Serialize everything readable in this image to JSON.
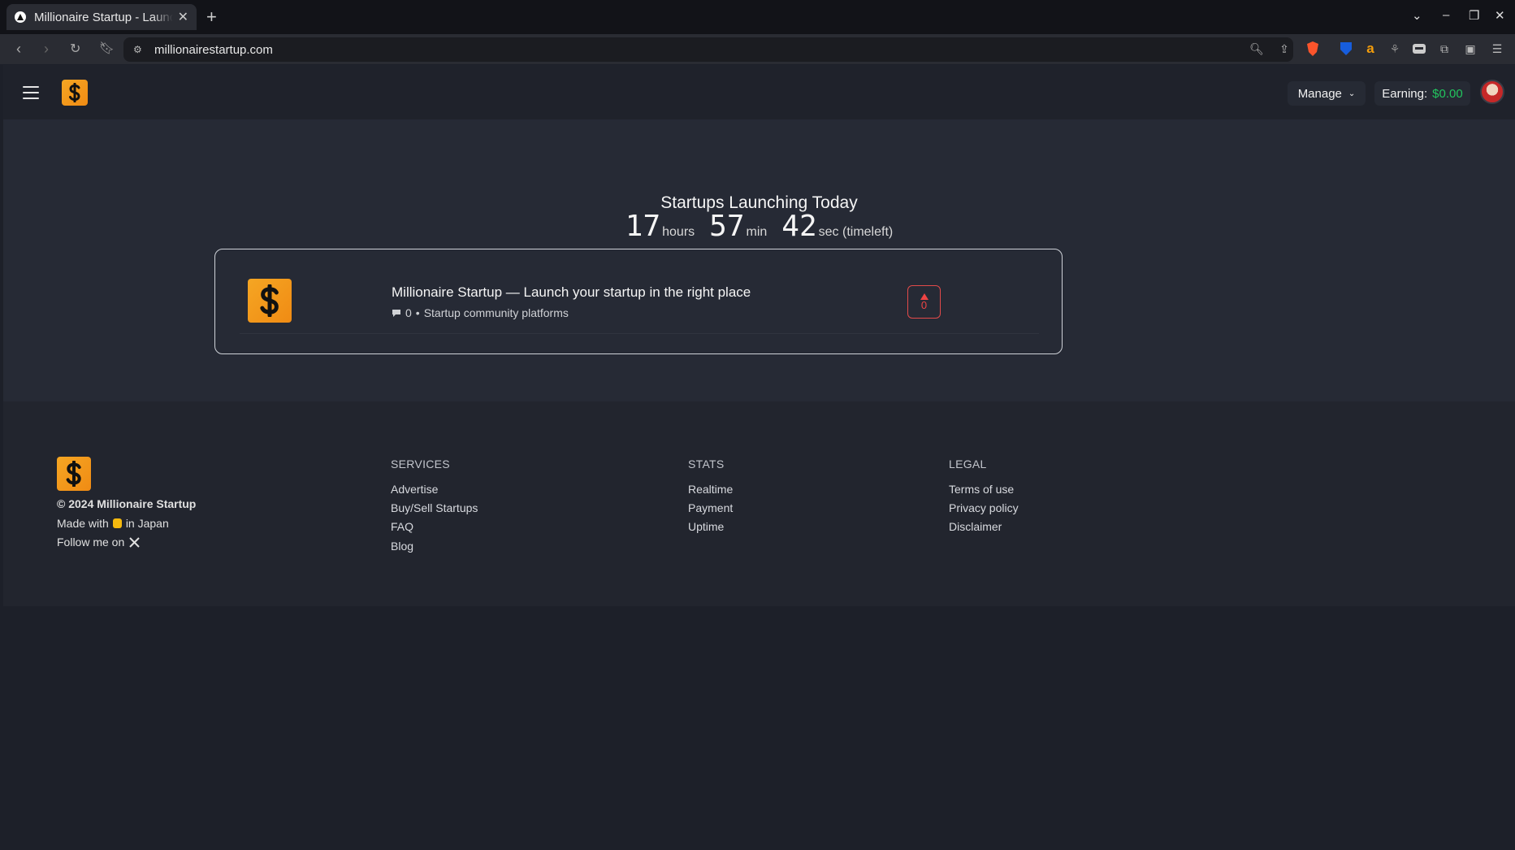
{
  "browser": {
    "tab_title": "Millionaire Startup - Launch",
    "url": "millionairestartup.com"
  },
  "header": {
    "manage_label": "Manage",
    "earning_label": "Earning:",
    "earning_value": "$0.00"
  },
  "hero": {
    "title": "Startups Launching Today",
    "hours": "17",
    "hours_unit": "hours",
    "minutes": "57",
    "minutes_unit": "min",
    "seconds": "42",
    "seconds_unit": "sec (timeleft)"
  },
  "listing": {
    "title": "Millionaire Startup — Launch your startup in the right place",
    "comments": "0",
    "separator": "•",
    "category": "Startup community platforms",
    "upvotes": "0"
  },
  "footer": {
    "copyright": "© 2024 Millionaire Startup",
    "made_with_prefix": "Made with",
    "made_with_suffix": "in Japan",
    "follow": "Follow me on",
    "columns": [
      {
        "heading": "SERVICES",
        "links": [
          "Advertise",
          "Buy/Sell Startups",
          "FAQ",
          "Blog"
        ]
      },
      {
        "heading": "STATS",
        "links": [
          "Realtime",
          "Payment",
          "Uptime"
        ]
      },
      {
        "heading": "LEGAL",
        "links": [
          "Terms of use",
          "Privacy policy",
          "Disclaimer"
        ]
      }
    ]
  },
  "colors": {
    "brand": "#f5a623",
    "earning": "#22c55e",
    "upvote": "#ef4444"
  },
  "icons": [
    "brave-shield-icon",
    "bitwarden-icon",
    "amazon-icon",
    "extensions-icon",
    "upvote-arrow-icon",
    "comment-icon",
    "x-logo-icon"
  ]
}
